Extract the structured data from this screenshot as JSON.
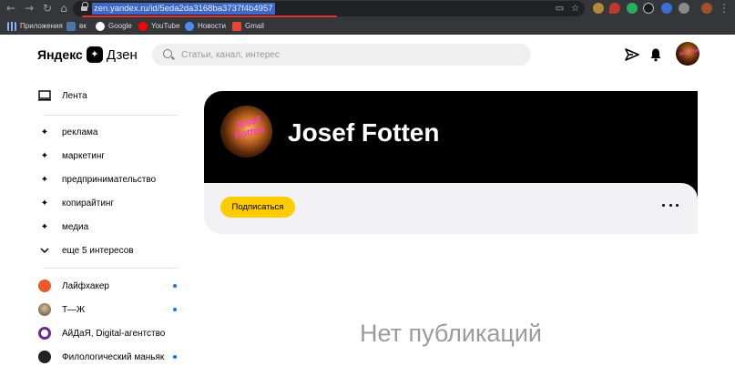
{
  "browser": {
    "url": "zen.yandex.ru/id/5eda2da3168ba3737f4b4957",
    "bookmarks": [
      "Приложения",
      "вк",
      "Google",
      "YouTube",
      "Новости",
      "Gmail"
    ]
  },
  "header": {
    "logo_left": "Яндекс",
    "logo_right": "Дзен",
    "search_placeholder": "Статьи, канал, интерес"
  },
  "sidebar": {
    "feed": "Лента",
    "interests": [
      "реклама",
      "маркетинг",
      "предпринимательство",
      "копирайтинг",
      "медиа"
    ],
    "more_interests": "еще 5 интересов",
    "channels": [
      {
        "name": "Лайфхакер",
        "unread": true,
        "color": "#e95c2a"
      },
      {
        "name": "Т—Ж",
        "unread": true,
        "color": "#7a6a50"
      },
      {
        "name": "АйДаЯ, Digital-агентство",
        "unread": false,
        "color": "#6a2c8a"
      },
      {
        "name": "Филологический маньяк",
        "unread": true,
        "color": "#222222"
      }
    ]
  },
  "channel": {
    "name": "Josef Fotten",
    "avatar_text": "Josef Fotten",
    "subscribe_label": "Подписаться"
  },
  "main": {
    "empty_text": "Нет публикаций"
  },
  "colors": {
    "accent": "#ffcc00",
    "unread_dot": "#1a73e8"
  }
}
